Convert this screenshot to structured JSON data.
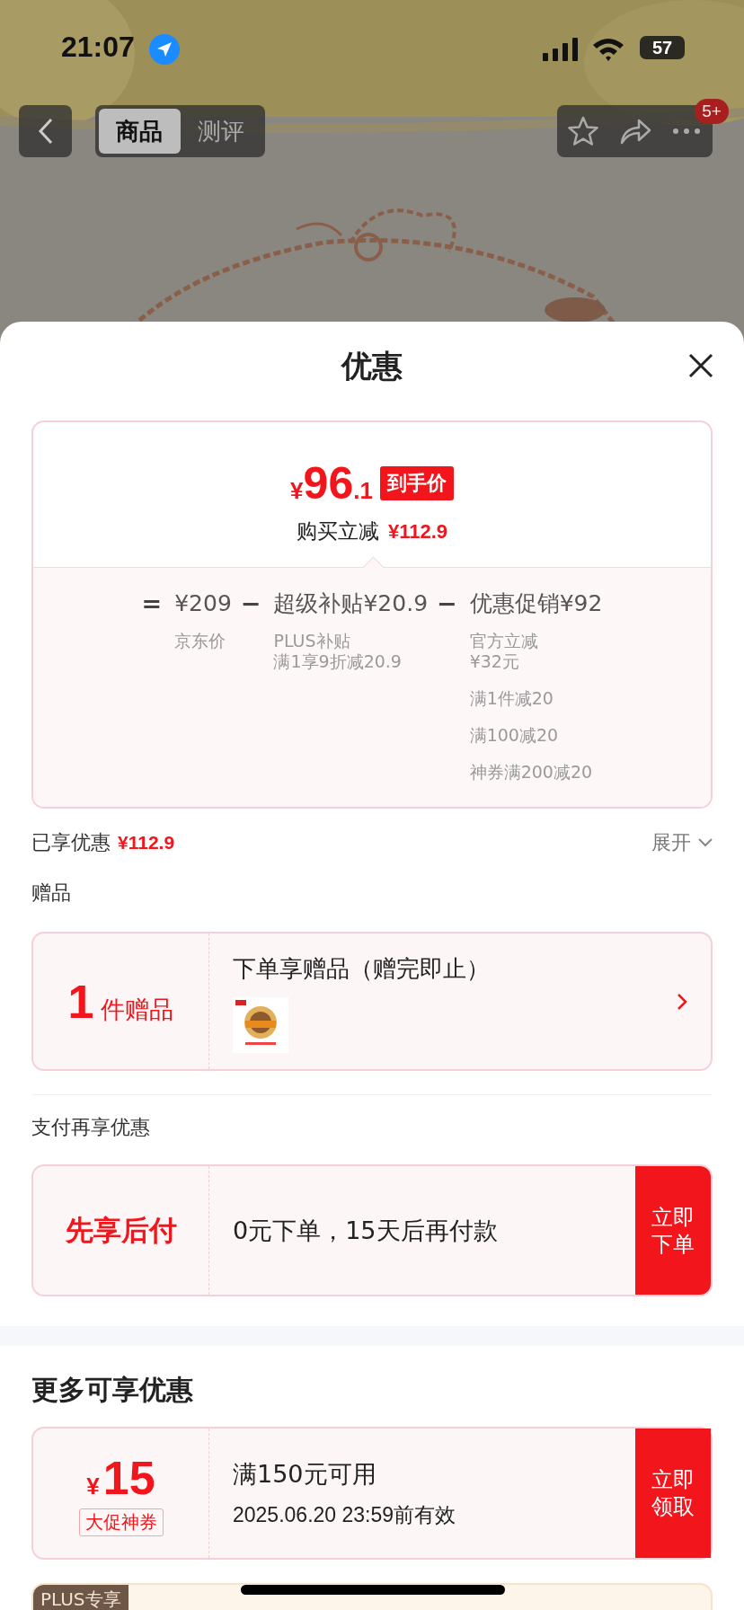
{
  "status_bar": {
    "time": "21:07",
    "battery": "57"
  },
  "nav": {
    "tabs": [
      {
        "label": "商品",
        "selected": true
      },
      {
        "label": "测评",
        "selected": false
      }
    ],
    "badge": "5+"
  },
  "sheet": {
    "title": "优惠"
  },
  "price_card": {
    "currency": "¥",
    "price_int": "96",
    "price_dec": ".1",
    "price_tag": "到手价",
    "reduction_label": "购买立减",
    "reduction_amount": "¥112.9",
    "breakdown": [
      {
        "operator": "=",
        "value": "¥209",
        "notes": [
          [
            "京东价"
          ]
        ]
      },
      {
        "operator": "−",
        "value": "超级补贴¥20.9",
        "notes": [
          [
            "PLUS补贴",
            "满1享9折减20.9"
          ]
        ]
      },
      {
        "operator": "−",
        "value": "优惠促销¥92",
        "notes": [
          [
            "官方立减",
            "¥32元"
          ],
          [
            "满1件减20"
          ],
          [
            "满100减20"
          ],
          [
            "神券满200减20"
          ]
        ]
      }
    ]
  },
  "enjoyed": {
    "label": "已享优惠",
    "amount": "¥112.9",
    "expand": "展开"
  },
  "gifts": {
    "heading": "赠品",
    "count": "1",
    "count_unit": "件赠品",
    "title": "下单享赠品（赠完即止）"
  },
  "pay_later": {
    "heading": "支付再享优惠",
    "name": "先享后付",
    "description": "0元下单，15天后再付款",
    "button": "立即下单"
  },
  "more": {
    "heading": "更多可享优惠",
    "coupons": [
      {
        "kind": "coupon",
        "currency": "¥",
        "amount": "15",
        "tag": "大促神券",
        "condition": "满150元可用",
        "validity": "2025.06.20 23:59前有效",
        "button": "立即领取"
      },
      {
        "kind": "plus",
        "badge": "PLUS专享"
      }
    ]
  }
}
